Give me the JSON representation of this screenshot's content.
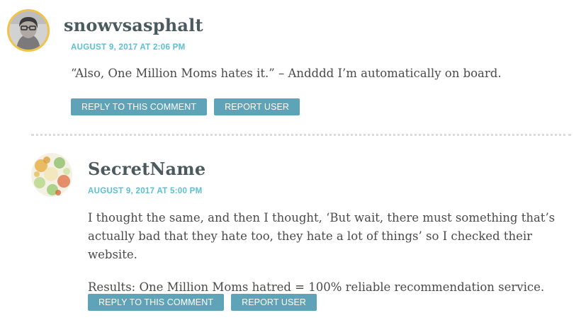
{
  "comments": [
    {
      "author": "snowvsasphalt",
      "date": "AUGUST 9, 2017 AT 2:06 PM",
      "paragraphs": [
        "“Also, One Million Moms hates it.” – Andddd I’m automatically on board."
      ],
      "reply_label": "REPLY TO THIS COMMENT",
      "report_label": "REPORT USER"
    },
    {
      "author": "SecretName",
      "date": "AUGUST 9, 2017 AT 5:00 PM",
      "paragraphs": [
        "I thought the same, and then I thought, ‘But wait, there must something that’s actually bad that they hate too, they hate a lot of things’ so I checked their website.",
        "Results: One Million Moms hatred = 100% reliable recommendation service."
      ],
      "reply_label": "REPLY TO THIS COMMENT",
      "report_label": "REPORT USER"
    }
  ],
  "colors": {
    "accent": "#5bbfd3",
    "button": "#5fa3b8",
    "author": "#4b5a5e",
    "avatar_ring": "#f0c24a"
  }
}
